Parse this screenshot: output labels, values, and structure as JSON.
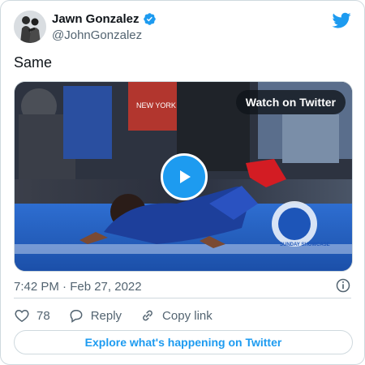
{
  "author": {
    "name": "Jawn Gonzalez",
    "handle": "@JohnGonzalez",
    "verified": true
  },
  "tweet": {
    "text": "Same",
    "timestamp": "7:42 PM · Feb 27, 2022"
  },
  "media": {
    "watch_label": "Watch on Twitter",
    "logo_text": "SUNDAY SHOWCASE"
  },
  "actions": {
    "like_count": "78",
    "reply_label": "Reply",
    "copy_link_label": "Copy link"
  },
  "footer": {
    "explore_label": "Explore what's happening on Twitter"
  },
  "colors": {
    "brand_blue": "#1d9bf0",
    "text_primary": "#0f1419",
    "text_secondary": "#536471",
    "border": "#cfd9de"
  },
  "icons": [
    "verified-badge-icon",
    "twitter-bird-icon",
    "play-icon",
    "info-icon",
    "heart-icon",
    "reply-icon",
    "link-icon"
  ]
}
